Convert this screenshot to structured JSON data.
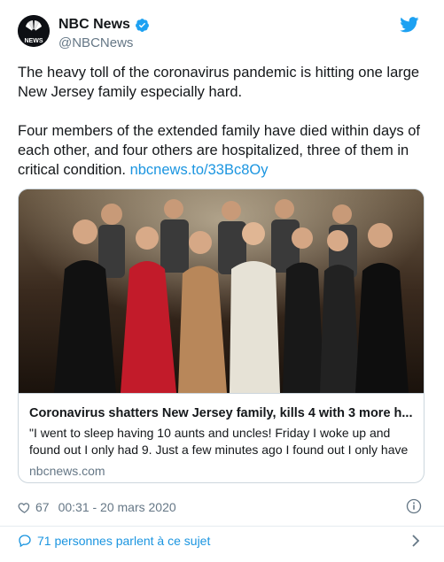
{
  "author": {
    "display_name": "NBC News",
    "handle": "@NBCNews",
    "avatar_text": "NEWS",
    "verified_icon": "verified-badge-icon",
    "brand_color": "#1da1f2"
  },
  "tweet": {
    "paragraph1": "The heavy toll of the coronavirus pandemic is hitting one large New Jersey family especially hard.",
    "paragraph2": "Four members of the extended family have died within days of each other, and four others are hospitalized, three of them in critical condition.",
    "link": "nbcnews.to/33Bc8Oy"
  },
  "card": {
    "image_alt": "photo-of-extended-family",
    "title": "Coronavirus shatters New Jersey family, kills 4 with 3 more h...",
    "description": "\"I went to sleep having 10 aunts and uncles! Friday I woke up and found out I only had 9. Just a few minutes ago I found out I only have",
    "domain": "nbcnews.com"
  },
  "meta": {
    "likes": "67",
    "timestamp": "00:31 - 20 mars 2020"
  },
  "footer": {
    "conversation_label": "71 personnes parlent à ce sujet"
  },
  "colors": {
    "text": "#14171a",
    "secondary": "#657786",
    "link": "#1b95e0",
    "border": "#ccd6dd"
  }
}
